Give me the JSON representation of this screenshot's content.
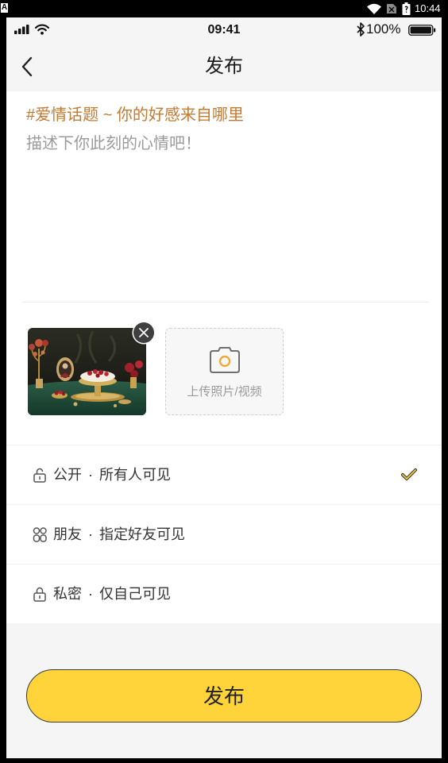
{
  "android_status": {
    "notification_icon_text": "A",
    "time": "10:44",
    "icons": [
      "wifi-icon",
      "no-sim-icon",
      "battery-icon"
    ]
  },
  "ios_status": {
    "time": "09:41",
    "battery_percent": "100%",
    "icons": [
      "signal-icon",
      "wifi-icon",
      "bluetooth-icon",
      "battery-icon"
    ]
  },
  "nav": {
    "back_icon": "chevron-left-icon",
    "title": "发布"
  },
  "compose": {
    "topic": "#爱情话题 ~ 你的好感来自哪里",
    "placeholder": "描述下你此刻的心情吧！"
  },
  "media": {
    "remove_icon": "close-icon",
    "upload_icon": "camera-icon",
    "upload_label": "上传照片/视频"
  },
  "visibility": {
    "options": [
      {
        "text": "公开 · 所有人可见",
        "icon": "lock-open-icon",
        "selected": true
      },
      {
        "text": "朋友 · 指定好友可见",
        "icon": "friends-icon",
        "selected": false
      },
      {
        "text": "私密 · 仅自己可见",
        "icon": "lock-icon",
        "selected": false
      }
    ],
    "selected_icon": "checkmark-icon"
  },
  "submit": {
    "label": "发布"
  },
  "colors": {
    "accent": "#FFD43B",
    "topic": "#C47A30",
    "placeholder": "#9A9A9A",
    "background": "#F5F5F5"
  }
}
